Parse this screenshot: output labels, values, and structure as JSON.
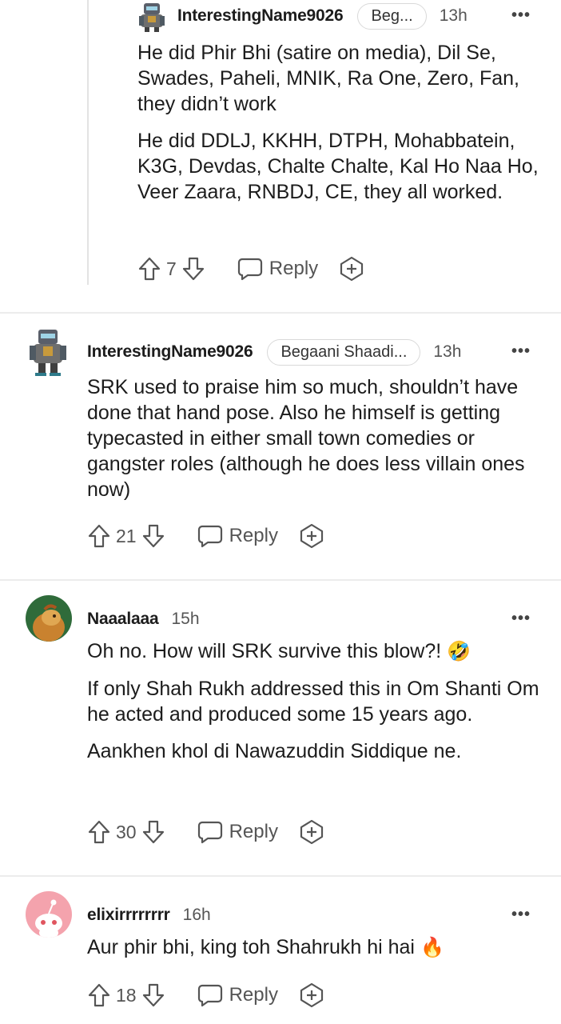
{
  "comments": [
    {
      "username": "InterestingName9026",
      "flair": "Beg...",
      "time": "13h",
      "more": "•••",
      "paragraphs": [
        "He did Phir Bhi (satire on media), Dil Se, Swades, Paheli, MNIK, Ra One, Zero, Fan, they didn’t work",
        "He did DDLJ, KKHH, DTPH, Mohabbatein, K3G, Devdas, Chalte Chalte, Kal Ho Naa Ho, Veer Zaara, RNBDJ, CE, they all worked."
      ],
      "score": "7",
      "reply_label": "Reply",
      "avatar_icon": "robot-avatar-icon"
    },
    {
      "username": "InterestingName9026",
      "flair": "Begaani Shaadi...",
      "time": "13h",
      "more": "•••",
      "paragraphs": [
        "SRK used to praise him so much, shouldn’t have done that hand pose. Also he himself is getting typecasted in either small town comedies or gangster roles (although he does less villain ones now)"
      ],
      "score": "21",
      "reply_label": "Reply",
      "avatar_icon": "robot-avatar-icon"
    },
    {
      "username": "Naaalaaa",
      "time": "15h",
      "more": "•••",
      "paragraphs": [
        "Oh no. How will SRK survive this blow?!",
        "If only Shah Rukh addressed this in Om Shanti Om he acted and produced some 15 years ago.",
        "Aankhen khol di Nawazuddin Siddique ne."
      ],
      "emoji": "🤣",
      "score": "30",
      "reply_label": "Reply",
      "avatar_icon": "lion-avatar-icon"
    },
    {
      "username": "elixirrrrrrrr",
      "time": "16h",
      "more": "•••",
      "paragraphs": [
        "Aur phir bhi, king toh Shahrukh hi hai"
      ],
      "emoji": "🔥",
      "score": "18",
      "reply_label": "Reply",
      "avatar_icon": "snoo-avatar-icon"
    }
  ]
}
